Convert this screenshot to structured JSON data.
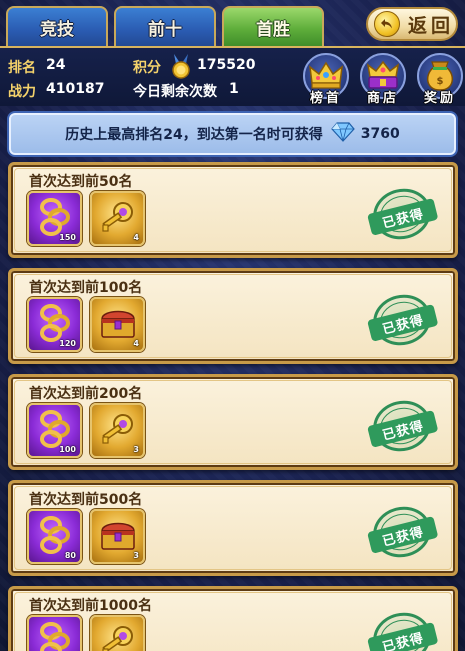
{
  "tabs": [
    {
      "label": "竞技",
      "active": false
    },
    {
      "label": "前十",
      "active": false
    },
    {
      "label": "首胜",
      "active": true
    }
  ],
  "return_label": "返回",
  "player": {
    "rank_label": "排名",
    "rank_value": "24",
    "power_label": "战力",
    "power_value": "410187",
    "points_label": "积分",
    "points_value": "175520",
    "remaining_label": "今日剩余次数",
    "remaining_value": "1"
  },
  "top_buttons": [
    {
      "label": "榜首",
      "icon": "crown-icon"
    },
    {
      "label": "商店",
      "icon": "treasure-crown-icon"
    },
    {
      "label": "奖励",
      "icon": "money-bag-icon"
    }
  ],
  "history": {
    "text": "历史上最高排名24，到达第一名时可获得",
    "reward_icon": "diamond-icon",
    "reward_value": "3760"
  },
  "claimed_label": "已获得",
  "milestones": [
    {
      "title": "首次达到前50名",
      "items": [
        {
          "icon": "gold-key-ring-icon",
          "frame": "purple",
          "qty": "150"
        },
        {
          "icon": "golden-key-icon",
          "frame": "gold",
          "qty": "4"
        }
      ]
    },
    {
      "title": "首次达到前100名",
      "items": [
        {
          "icon": "gold-key-ring-icon",
          "frame": "purple",
          "qty": "120"
        },
        {
          "icon": "treasure-chest-icon",
          "frame": "gold",
          "qty": "4"
        }
      ]
    },
    {
      "title": "首次达到前200名",
      "items": [
        {
          "icon": "gold-key-ring-icon",
          "frame": "purple",
          "qty": "100"
        },
        {
          "icon": "golden-key-icon",
          "frame": "gold",
          "qty": "3"
        }
      ]
    },
    {
      "title": "首次达到前500名",
      "items": [
        {
          "icon": "gold-key-ring-icon",
          "frame": "purple",
          "qty": "80"
        },
        {
          "icon": "treasure-chest-icon",
          "frame": "gold",
          "qty": "3"
        }
      ]
    },
    {
      "title": "首次达到前1000名",
      "items": [
        {
          "icon": "gold-key-ring-icon",
          "frame": "purple",
          "qty": ""
        },
        {
          "icon": "golden-key-icon",
          "frame": "gold",
          "qty": ""
        }
      ]
    }
  ],
  "colors": {
    "tab_blue": "#2a5bb1",
    "tab_green": "#5fae3b",
    "gold_text": "#f4d26b",
    "stamp_green": "#2e8f57",
    "card_bg": "#fbf2dd"
  }
}
